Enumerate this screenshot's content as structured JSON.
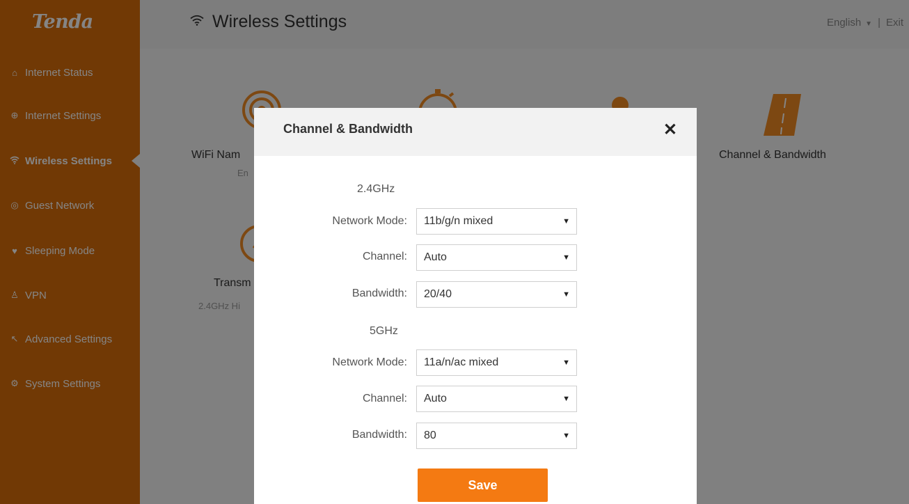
{
  "brand": {
    "logo": "Tenda"
  },
  "sidebar": {
    "items": [
      {
        "label": "Internet Status",
        "icon": "router-icon",
        "glyph": "⌂",
        "active": false
      },
      {
        "label": "Internet Settings",
        "icon": "globe-icon",
        "glyph": "⊕",
        "active": false
      },
      {
        "label": "Wireless Settings",
        "icon": "wifi-icon",
        "glyph": "≋",
        "active": true
      },
      {
        "label": "Guest Network",
        "icon": "guest-icon",
        "glyph": "◎",
        "active": false
      },
      {
        "label": "Sleeping Mode",
        "icon": "bulb-icon",
        "glyph": "♥",
        "active": false
      },
      {
        "label": "VPN",
        "icon": "vpn-icon",
        "glyph": "♙",
        "active": false
      },
      {
        "label": "Advanced Settings",
        "icon": "tools-icon",
        "glyph": "↖",
        "active": false
      },
      {
        "label": "System Settings",
        "icon": "gear-icon",
        "glyph": "⚙",
        "active": false
      }
    ]
  },
  "header": {
    "title": "Wireless Settings",
    "language": "English",
    "separator": "|",
    "exit": "Exit"
  },
  "tiles": {
    "wifi_name": {
      "title": "WiFi Nam",
      "sub": "En"
    },
    "channel_bandwidth": {
      "title": "Channel & Bandwidth"
    },
    "transmit": {
      "title": "Transm",
      "sub": "2.4GHz Hi"
    }
  },
  "modal": {
    "title": "Channel & Bandwidth",
    "close": "✕",
    "band24": {
      "heading": "2.4GHz",
      "network_mode_label": "Network Mode:",
      "network_mode_value": "11b/g/n mixed",
      "channel_label": "Channel:",
      "channel_value": "Auto",
      "bandwidth_label": "Bandwidth:",
      "bandwidth_value": "20/40"
    },
    "band5": {
      "heading": "5GHz",
      "network_mode_label": "Network Mode:",
      "network_mode_value": "11a/n/ac mixed",
      "channel_label": "Channel:",
      "channel_value": "Auto",
      "bandwidth_label": "Bandwidth:",
      "bandwidth_value": "80"
    },
    "save_label": "Save"
  },
  "colors": {
    "brand_orange": "#d96d0a",
    "button_orange": "#f47a12",
    "tile_icon_orange": "#f08a24"
  }
}
